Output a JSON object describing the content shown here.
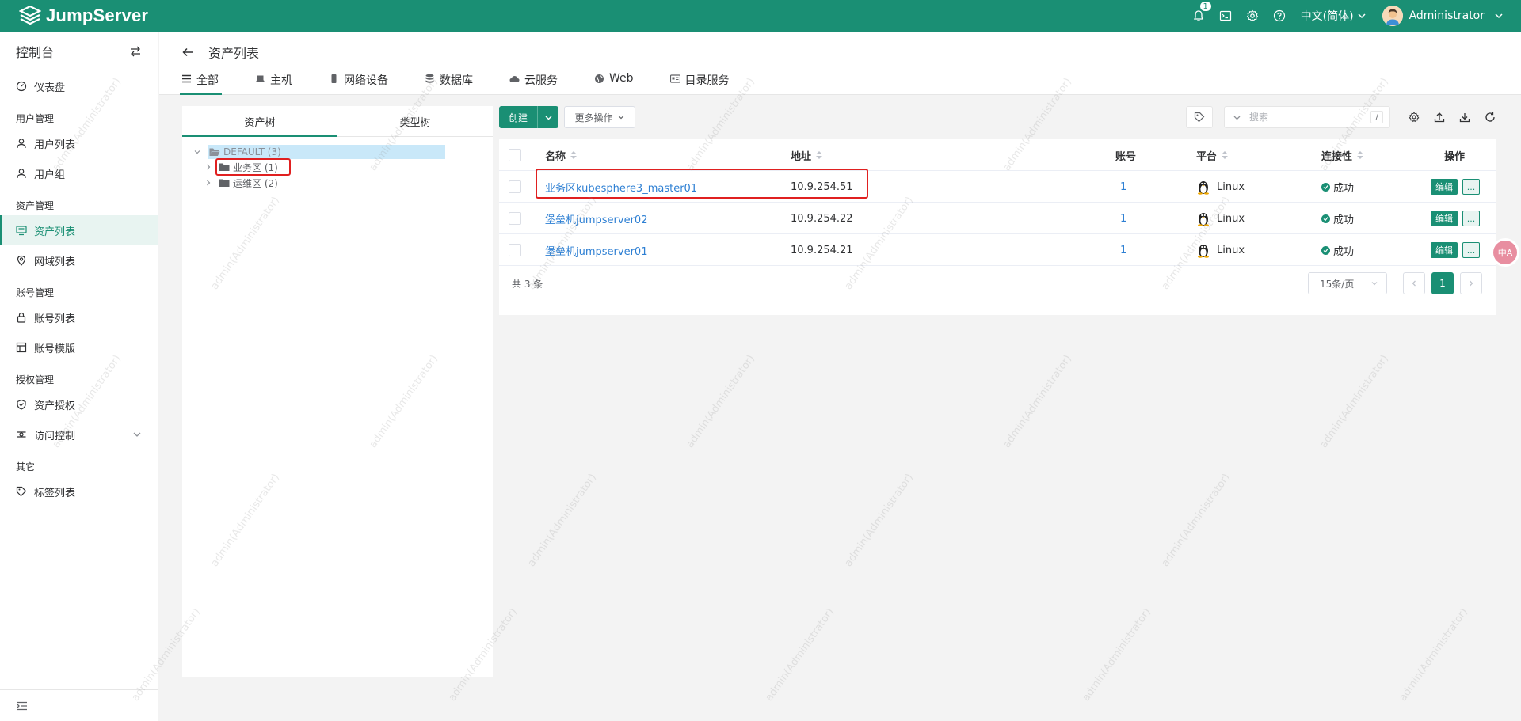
{
  "brand": {
    "name": "JumpServer"
  },
  "topbar": {
    "notification_count": "1",
    "language": "中文(简体)",
    "user": "Administrator"
  },
  "sidebar": {
    "title": "控制台",
    "dashboard": "仪表盘",
    "groups": [
      {
        "label": "用户管理",
        "items": [
          "用户列表",
          "用户组"
        ]
      },
      {
        "label": "资产管理",
        "items": [
          "资产列表",
          "网域列表"
        ]
      },
      {
        "label": "账号管理",
        "items": [
          "账号列表",
          "账号模版"
        ]
      },
      {
        "label": "授权管理",
        "items": [
          "资产授权",
          "访问控制"
        ]
      },
      {
        "label": "其它",
        "items": [
          "标签列表"
        ]
      }
    ],
    "active_item": "资产列表"
  },
  "page": {
    "title": "资产列表",
    "tabs": [
      {
        "label": "全部",
        "icon": "list-icon",
        "active": true
      },
      {
        "label": "主机",
        "icon": "host-icon"
      },
      {
        "label": "网络设备",
        "icon": "network-device-icon"
      },
      {
        "label": "数据库",
        "icon": "database-icon"
      },
      {
        "label": "云服务",
        "icon": "cloud-icon"
      },
      {
        "label": "Web",
        "icon": "globe-icon"
      },
      {
        "label": "目录服务",
        "icon": "directory-icon"
      }
    ]
  },
  "tree": {
    "tabs": [
      "资产树",
      "类型树"
    ],
    "root": "DEFAULT (3)",
    "children": [
      "业务区 (1)",
      "运维区 (2)"
    ]
  },
  "toolbar": {
    "create_label": "创建",
    "more_label": "更多操作",
    "search_placeholder": "搜索",
    "search_shortcut": "/"
  },
  "table": {
    "columns": [
      "名称",
      "地址",
      "账号",
      "平台",
      "连接性",
      "操作"
    ],
    "rows": [
      {
        "name": "业务区kubesphere3_master01",
        "address": "10.9.254.51",
        "accounts": "1",
        "platform": "Linux",
        "connectivity": "成功"
      },
      {
        "name": "堡垒机jumpserver02",
        "address": "10.9.254.22",
        "accounts": "1",
        "platform": "Linux",
        "connectivity": "成功"
      },
      {
        "name": "堡垒机jumpserver01",
        "address": "10.9.254.21",
        "accounts": "1",
        "platform": "Linux",
        "connectivity": "成功"
      }
    ],
    "edit_label": "编辑",
    "more_label": "...",
    "total": "共 3 条",
    "page_size": "15条/页",
    "current_page": "1"
  },
  "watermark": "admin(Administrator)",
  "float_button": "中A",
  "colors": {
    "brand": "#1a8f74",
    "link": "#2d7fd3",
    "highlight_box": "#e02020"
  }
}
